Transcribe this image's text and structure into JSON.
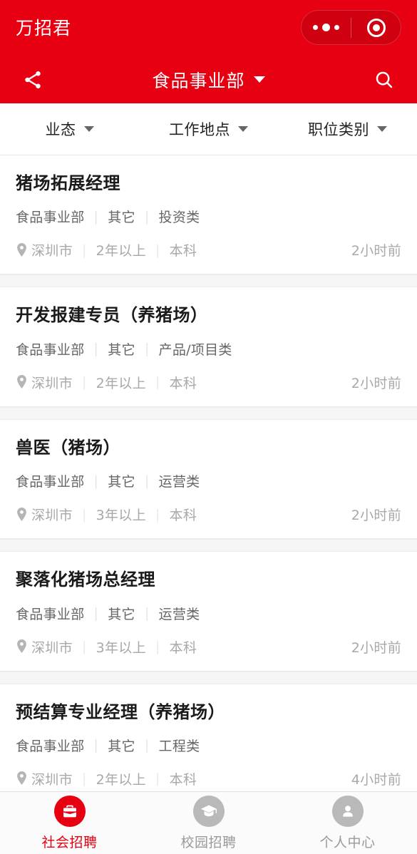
{
  "theme": {
    "brand_red": "#e60012",
    "capsule_red": "#cf0010",
    "title_color": "#1a1a1a",
    "tag_color": "#666666",
    "meta_color": "#a8a8a8",
    "page_bg": "#f4f4f4"
  },
  "header": {
    "app_name": "万招君",
    "nav_title": "食品事业部",
    "share_icon": "share-icon",
    "search_icon": "search-icon",
    "title_caret_icon": "chevron-down-icon",
    "capsule": {
      "more_icon": "more-dots-icon",
      "target_icon": "target-circle-icon"
    }
  },
  "filters": [
    {
      "label": "业态",
      "caret_icon": "chevron-down-icon"
    },
    {
      "label": "工作地点",
      "caret_icon": "chevron-down-icon"
    },
    {
      "label": "职位类别",
      "caret_icon": "chevron-down-icon"
    }
  ],
  "jobs": [
    {
      "title": "猪场拓展经理",
      "department": "食品事业部",
      "business": "其它",
      "category": "投资类",
      "location": "深圳市",
      "experience": "2年以上",
      "education": "本科",
      "time": "2小时前",
      "pin_icon": "location-pin-icon"
    },
    {
      "title": "开发报建专员（养猪场）",
      "department": "食品事业部",
      "business": "其它",
      "category": "产品/项目类",
      "location": "深圳市",
      "experience": "2年以上",
      "education": "本科",
      "time": "2小时前",
      "pin_icon": "location-pin-icon"
    },
    {
      "title": "兽医（猪场）",
      "department": "食品事业部",
      "business": "其它",
      "category": "运营类",
      "location": "深圳市",
      "experience": "3年以上",
      "education": "本科",
      "time": "2小时前",
      "pin_icon": "location-pin-icon"
    },
    {
      "title": "聚落化猪场总经理",
      "department": "食品事业部",
      "business": "其它",
      "category": "运营类",
      "location": "深圳市",
      "experience": "3年以上",
      "education": "本科",
      "time": "2小时前",
      "pin_icon": "location-pin-icon"
    },
    {
      "title": "预结算专业经理（养猪场）",
      "department": "食品事业部",
      "business": "其它",
      "category": "工程类",
      "location": "深圳市",
      "experience": "2年以上",
      "education": "本科",
      "time": "4小时前",
      "pin_icon": "location-pin-icon"
    }
  ],
  "separator": "|",
  "tabbar": [
    {
      "label": "社会招聘",
      "icon": "briefcase-icon",
      "active": true
    },
    {
      "label": "校园招聘",
      "icon": "graduation-cap-icon",
      "active": false
    },
    {
      "label": "个人中心",
      "icon": "person-icon",
      "active": false
    }
  ]
}
